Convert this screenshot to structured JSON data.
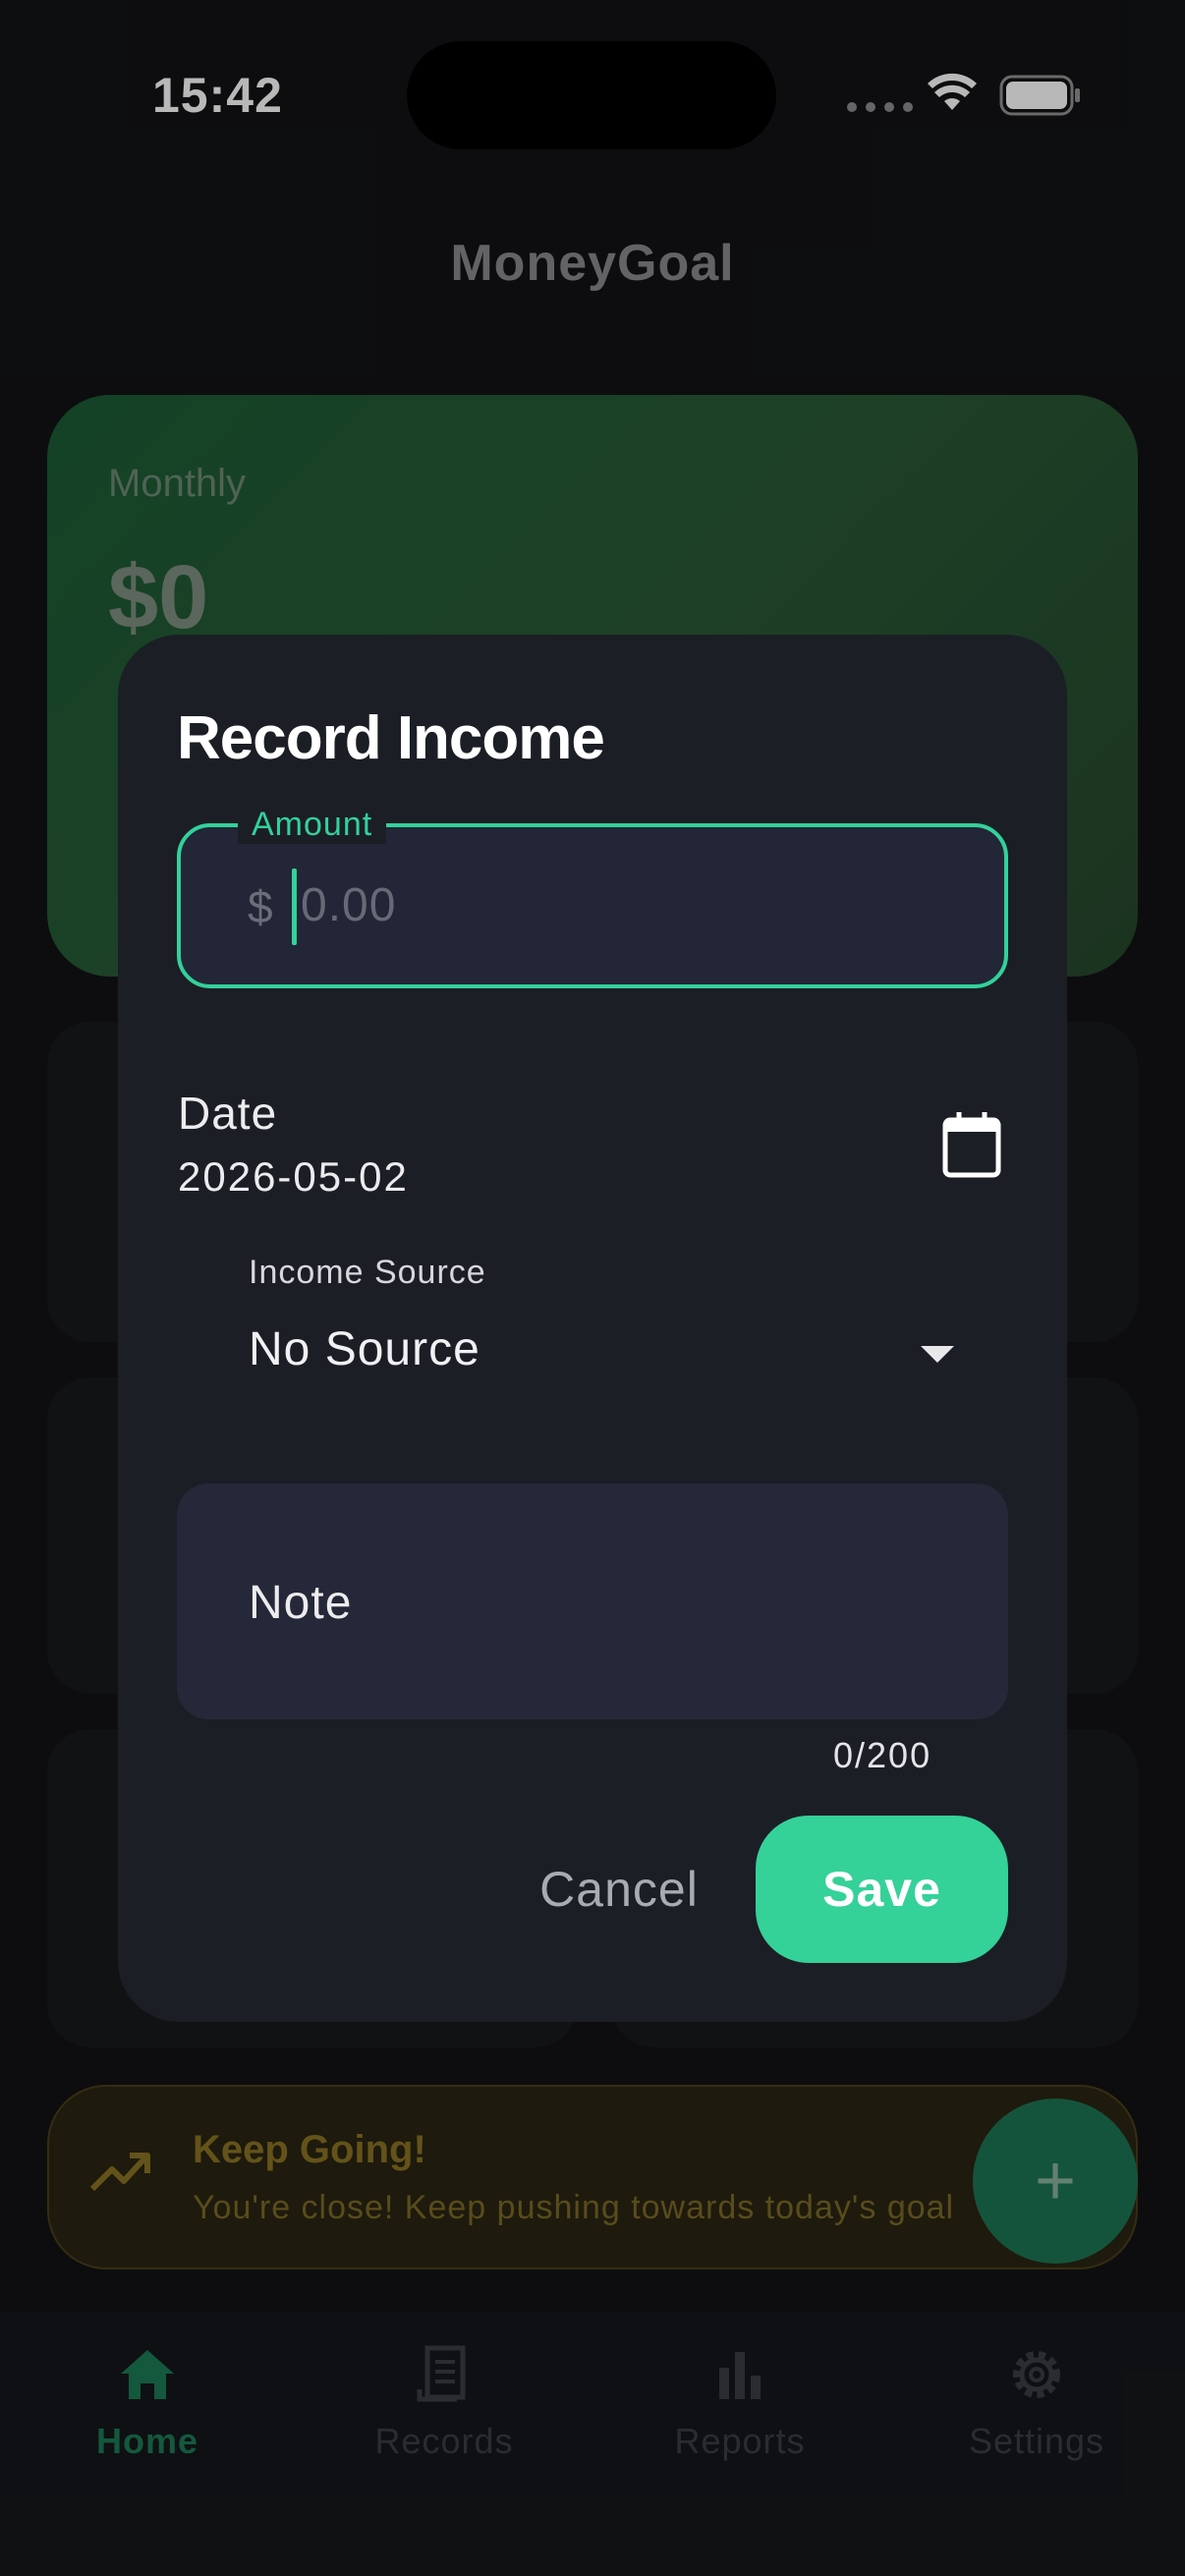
{
  "status_bar": {
    "time": "15:42"
  },
  "app": {
    "title": "MoneyGoal"
  },
  "monthly_card": {
    "label": "Monthly",
    "value": "$0"
  },
  "banner": {
    "title": "Keep Going!",
    "text": "You're close! Keep pushing towards today's goal"
  },
  "fab": {
    "label": "+"
  },
  "bottom_nav": {
    "items": [
      {
        "label": "Home",
        "icon": "home-icon",
        "active": true
      },
      {
        "label": "Records",
        "icon": "receipt-icon",
        "active": false
      },
      {
        "label": "Reports",
        "icon": "bar-chart-icon",
        "active": false
      },
      {
        "label": "Settings",
        "icon": "gear-icon",
        "active": false
      }
    ]
  },
  "dialog": {
    "title": "Record Income",
    "amount": {
      "label": "Amount",
      "prefix": "$",
      "placeholder": "0.00",
      "value": ""
    },
    "date": {
      "label": "Date",
      "value": "2026-05-02"
    },
    "income_source": {
      "label": "Income Source",
      "selected": "No Source"
    },
    "note": {
      "label": "Note",
      "counter": "0/200"
    },
    "cancel_label": "Cancel",
    "save_label": "Save"
  },
  "colors": {
    "accent": "#34d198",
    "dialog_bg": "#1c1e26",
    "background": "#121316",
    "banner_text": "#8a7424"
  }
}
